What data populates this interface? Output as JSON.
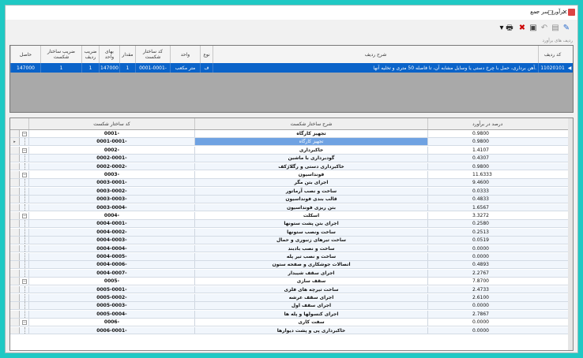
{
  "window": {
    "title": "برآورد سر جمع"
  },
  "sublabel": "ردیف های برآورد",
  "grid1": {
    "columns": [
      "کد ردیف",
      "شرح ردیف",
      "نوع",
      "واحد",
      "کد ساختار شکست",
      "مقدار",
      "بهای واحد",
      "ضریب ردیف",
      "ضریب ساختار شکست",
      "حاصل"
    ],
    "row": {
      "code": "11020101",
      "desc": "آهن برداری، حمل با چرخ دستی یا وسایل مشابه آن، تا فاصله 50 متری و تخلیه آنها.",
      "type": "ف",
      "unit": "متر مکعب",
      "wbs": "0001-0001-",
      "qty": "1",
      "price": "147000",
      "rowcoef": "1",
      "wbscoef": "1",
      "result": "147000"
    }
  },
  "grid2": {
    "columns": [
      "کد ساختار شکست",
      "شرح ساختار شکست",
      "درصد در برآورد"
    ],
    "rows": [
      {
        "code": "0001-",
        "desc": "تجهیز کارگاه",
        "pct": "0.9800",
        "grp": true
      },
      {
        "code": "0001-0001-",
        "desc": "تجهیز کارگاه",
        "pct": "0.9800",
        "hl": true
      },
      {
        "code": "0002-",
        "desc": "خاکبرداری",
        "pct": "1.4107",
        "grp": true
      },
      {
        "code": "0002-0001-",
        "desc": "گودبرداری با ماشین",
        "pct": "0.4307"
      },
      {
        "code": "0002-0002-",
        "desc": "خاکبرداری دستی و رگلاژکف",
        "pct": "0.9800"
      },
      {
        "code": "0003-",
        "desc": "فونداسیون",
        "pct": "11.6333",
        "grp": true
      },
      {
        "code": "0003-0001-",
        "desc": "اجرای بتن مگر",
        "pct": "9.4600"
      },
      {
        "code": "0003-0002-",
        "desc": "ساخت و نصب آرماتور",
        "pct": "0.0333"
      },
      {
        "code": "0003-0003-",
        "desc": "قالب بندی فونداسیون",
        "pct": "0.4833"
      },
      {
        "code": "0003-0004-",
        "desc": "بتن ریزی فونداسیون",
        "pct": "1.6567"
      },
      {
        "code": "0004-",
        "desc": "اسکلت",
        "pct": "3.3272",
        "grp": true
      },
      {
        "code": "0004-0001-",
        "desc": "اجرای بتن پشت ستونها",
        "pct": "0.2580"
      },
      {
        "code": "0004-0002-",
        "desc": "ساخت ونصب ستونها",
        "pct": "0.2513"
      },
      {
        "code": "0004-0003-",
        "desc": "ساخت تیرهای زنبوری و حمال",
        "pct": "0.0519"
      },
      {
        "code": "0004-0004-",
        "desc": "ساخت و نصب بادبند",
        "pct": "0.0000"
      },
      {
        "code": "0004-0005-",
        "desc": "ساخت و نصب تیر پله",
        "pct": "0.0000"
      },
      {
        "code": "0004-0006-",
        "desc": "اتصالات جوشکاری و صفحه ستون",
        "pct": "0.4893"
      },
      {
        "code": "0004-0007-",
        "desc": "اجرای سقف شیبدار",
        "pct": "2.2767"
      },
      {
        "code": "0005-",
        "desc": "سقف سازی",
        "pct": "7.8700",
        "grp": true
      },
      {
        "code": "0005-0001-",
        "desc": "ساخت تیرچه های فلزی",
        "pct": "2.4733"
      },
      {
        "code": "0005-0002-",
        "desc": "اجرای سقف عرشه",
        "pct": "2.6100"
      },
      {
        "code": "0005-0003-",
        "desc": "اجرای سقف اول",
        "pct": "0.0000"
      },
      {
        "code": "0005-0004-",
        "desc": "اجرای کنسولها و پله ها",
        "pct": "2.7867"
      },
      {
        "code": "0006-",
        "desc": "سفت کاری",
        "pct": "0.0000",
        "grp": true
      },
      {
        "code": "0006-0001-",
        "desc": "خاکبرداری پی و پشت دیوارها",
        "pct": "0.0000"
      }
    ]
  }
}
